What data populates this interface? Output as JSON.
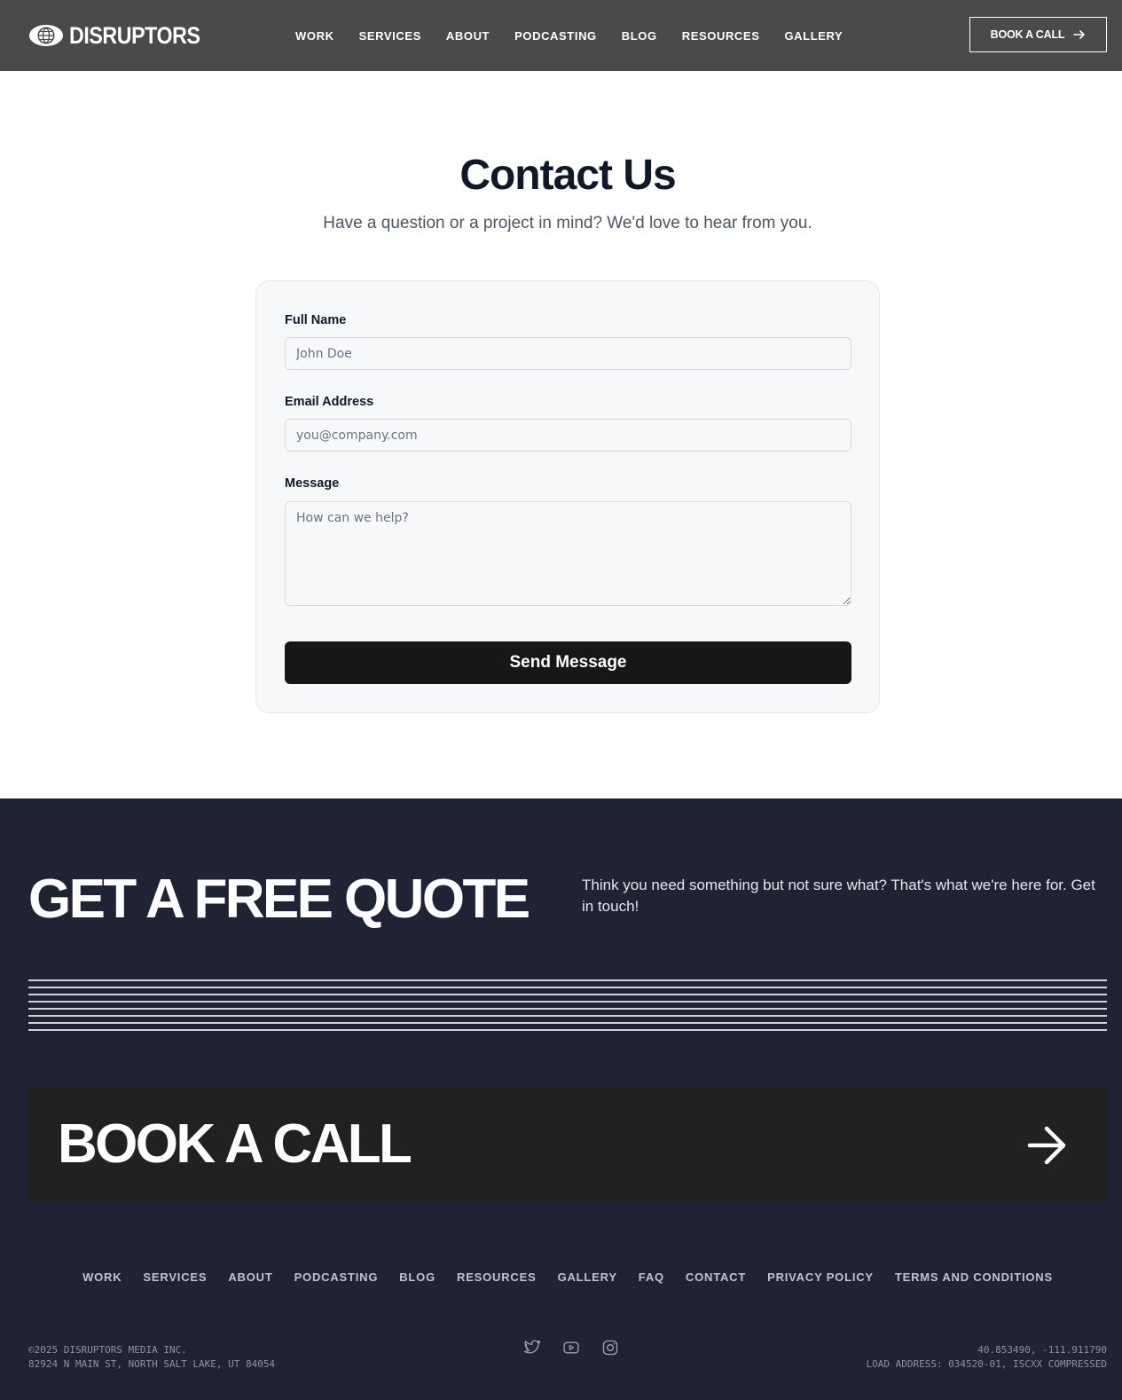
{
  "header": {
    "logo_text": "DISRUPTORS",
    "nav": [
      "WORK",
      "SERVICES",
      "ABOUT",
      "PODCASTING",
      "BLOG",
      "RESOURCES",
      "GALLERY"
    ],
    "cta_label": "BOOK A CALL",
    "cta_icon": "arrow-right-icon"
  },
  "contact": {
    "title": "Contact Us",
    "subtitle": "Have a question or a project in mind? We'd love to hear from you.",
    "form": {
      "name_label": "Full Name",
      "name_placeholder": "John Doe",
      "email_label": "Email Address",
      "email_placeholder": "you@company.com",
      "message_label": "Message",
      "message_placeholder": "How can we help?",
      "submit_label": "Send Message"
    }
  },
  "footer": {
    "quote_title": "GET A FREE QUOTE",
    "quote_text": "Think you need something but not sure what? That's what we're here for. Get in touch!",
    "book_call_label": "BOOK A CALL",
    "book_call_icon": "arrow-right-icon",
    "nav": [
      "WORK",
      "SERVICES",
      "ABOUT",
      "PODCASTING",
      "BLOG",
      "RESOURCES",
      "GALLERY",
      "FAQ",
      "CONTACT",
      "PRIVACY POLICY",
      "TERMS AND CONDITIONS"
    ],
    "copyright": "©2025 DISRUPTORS MEDIA INC.",
    "address": "82924 N MAIN ST, NORTH SALT LAKE, UT 84054",
    "coordinates": "40.853490, -111.911790",
    "load_address": "LOAD ADDRESS: 034520-01, ISCXX COMPRESSED",
    "socials": [
      "twitter-icon",
      "youtube-icon",
      "instagram-icon"
    ]
  },
  "colors": {
    "header_bg": "#4a4a48",
    "footer_bg": "#1f2333",
    "button_dark": "#171717",
    "panel_dark": "#212121"
  }
}
